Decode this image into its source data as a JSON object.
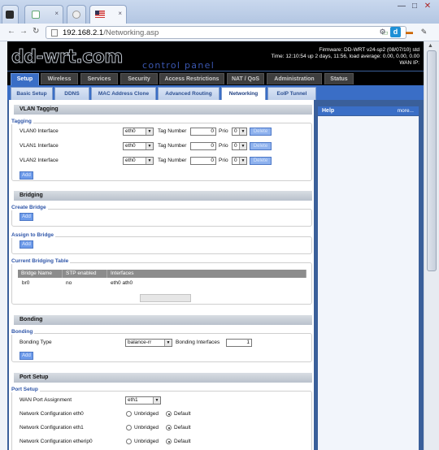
{
  "browser": {
    "tab_close": "×",
    "window_controls": [
      "—",
      "□",
      "✕"
    ],
    "nav": {
      "back": "←",
      "forward": "→",
      "reload": "↻"
    },
    "url_host": "192.168.2.1",
    "url_path": "/Networking.asp",
    "ext_d": "d"
  },
  "header": {
    "logo": "dd-wrt.com",
    "subtitle": "control panel",
    "firmware": "Firmware: DD-WRT v24-sp2 (08/07/10) std",
    "time": "Time: 12:10:54 up 2 days, 11:56, load average: 0.00, 0.00, 0.00",
    "wan_ip": "WAN IP:"
  },
  "main_tabs": [
    "Setup",
    "Wireless",
    "Services",
    "Security",
    "Access Restrictions",
    "NAT / QoS",
    "Administration",
    "Status"
  ],
  "sub_tabs": [
    "Basic Setup",
    "DDNS",
    "MAC Address Clone",
    "Advanced Routing",
    "Networking",
    "EoIP Tunnel"
  ],
  "help": {
    "title": "Help",
    "more": "more..."
  },
  "vlan": {
    "section": "VLAN Tagging",
    "legend": "Tagging",
    "tag_label": "Tag Number",
    "prio_label": "Prio",
    "delete_label": "Delete",
    "add_label": "Add",
    "rows": [
      {
        "label": "VLAN0 Interface",
        "iface": "eth0",
        "tag": "0",
        "prio": "0"
      },
      {
        "label": "VLAN1 Interface",
        "iface": "eth0",
        "tag": "0",
        "prio": "0"
      },
      {
        "label": "VLAN2 Interface",
        "iface": "eth0",
        "tag": "0",
        "prio": "0"
      }
    ]
  },
  "bridging": {
    "section": "Bridging",
    "create_legend": "Create Bridge",
    "assign_legend": "Assign to Bridge",
    "add_label": "Add",
    "table_legend": "Current Bridging Table",
    "columns": [
      "Bridge Name",
      "STP enabled",
      "Interfaces"
    ],
    "row": [
      "br0",
      "no",
      "eth0 ath0"
    ]
  },
  "bonding": {
    "section": "Bonding",
    "legend": "Bonding",
    "type_label": "Bonding Type",
    "type_value": "balance-rr",
    "ifaces_label": "Bonding Interfaces",
    "ifaces_value": "1",
    "add_label": "Add"
  },
  "port": {
    "section": "Port Setup",
    "legend": "Port Setup",
    "wan_label": "WAN Port Assignment",
    "wan_value": "eth1",
    "unbridged": "Unbridged",
    "default": "Default",
    "rows": [
      {
        "label": "Network Configuration eth0",
        "selected": "Default"
      },
      {
        "label": "Network Configuration eth1",
        "selected": "Default"
      },
      {
        "label": "Network Configuration etherip0",
        "selected": "Default"
      }
    ]
  }
}
